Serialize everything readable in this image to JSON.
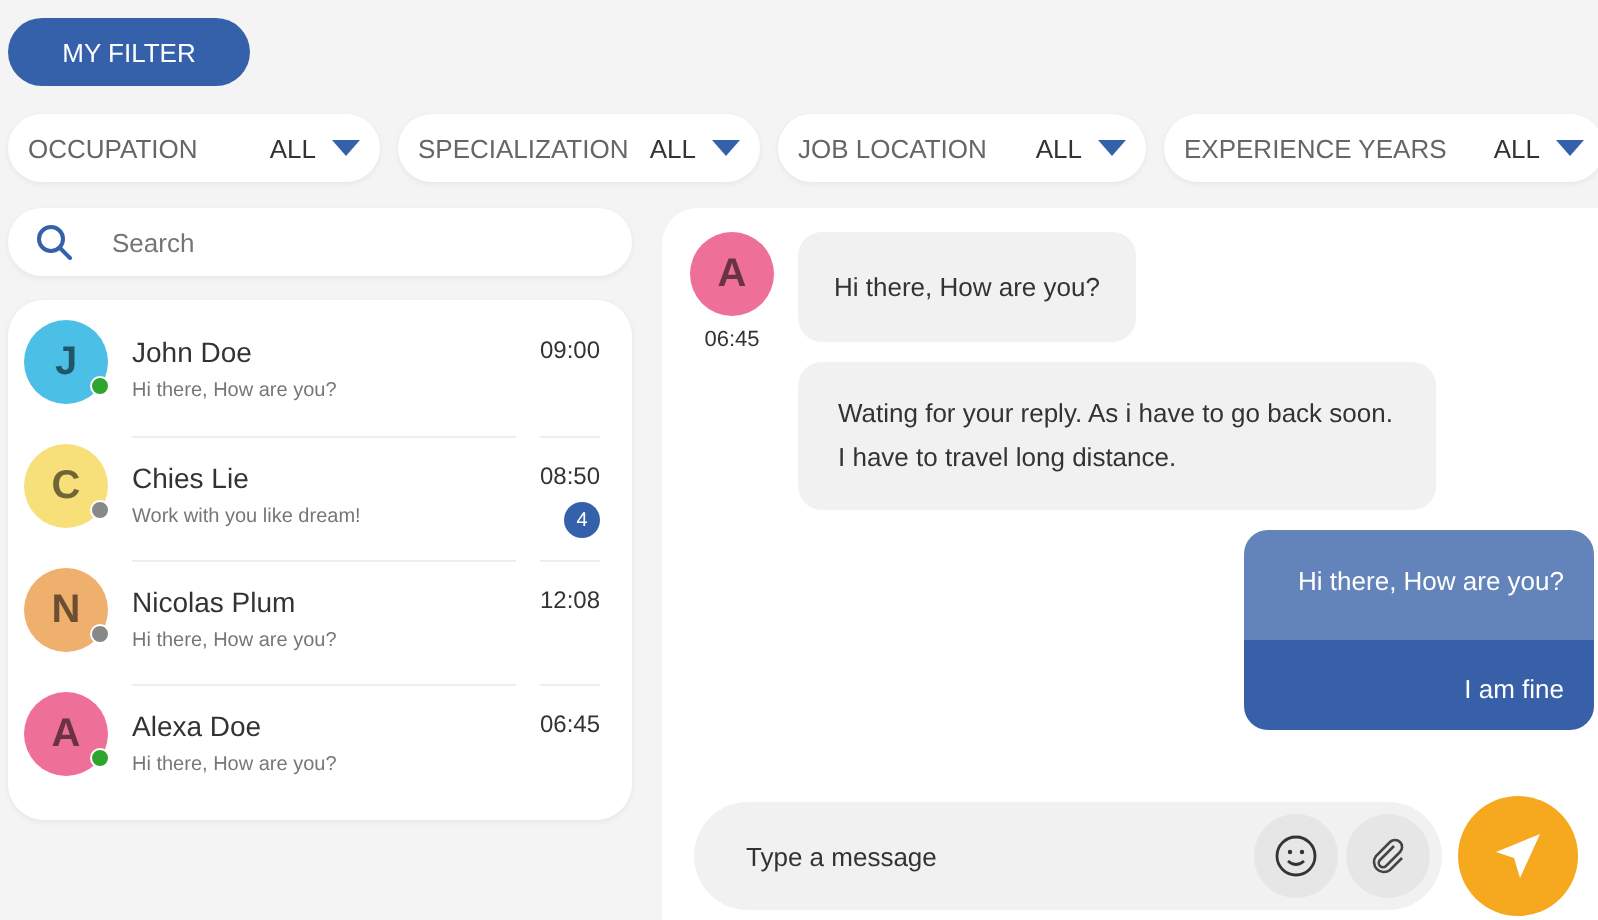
{
  "filter_button": {
    "label": "MY FILTER"
  },
  "filters": [
    {
      "label": "OCCUPATION",
      "value": "ALL"
    },
    {
      "label": "SPECIALIZATION",
      "value": "ALL"
    },
    {
      "label": "JOB LOCATION",
      "value": "ALL"
    },
    {
      "label": "EXPERIENCE YEARS",
      "value": "ALL"
    }
  ],
  "search": {
    "placeholder": "Search"
  },
  "contacts": [
    {
      "initial": "J",
      "name": "John Doe",
      "preview": "Hi there, How are you?",
      "time": "09:00",
      "color": "#4bbfe6",
      "online": true
    },
    {
      "initial": "C",
      "name": "Chies Lie",
      "preview": "Work with you like dream!",
      "time": "08:50",
      "color": "#f7e07a",
      "online": false,
      "unread": "4"
    },
    {
      "initial": "N",
      "name": "Nicolas Plum",
      "preview": "Hi there, How are you?",
      "time": "12:08",
      "color": "#eeb06c",
      "online": false
    },
    {
      "initial": "A",
      "name": "Alexa Doe",
      "preview": "Hi there, How are you?",
      "time": "06:45",
      "color": "#ee6f98",
      "online": true
    }
  ],
  "chat": {
    "avatar": {
      "initial": "A",
      "color": "#ee6f98"
    },
    "time": "06:45",
    "incoming": [
      "Hi there, How are you?",
      "Wating for your reply. As i have to go back soon. I have to travel long distance."
    ],
    "outgoing": [
      {
        "text": "Hi there, How are you?",
        "highlighted": false
      },
      {
        "text": "I am fine",
        "highlighted": true
      }
    ],
    "composer": {
      "placeholder": "Type a message"
    }
  }
}
